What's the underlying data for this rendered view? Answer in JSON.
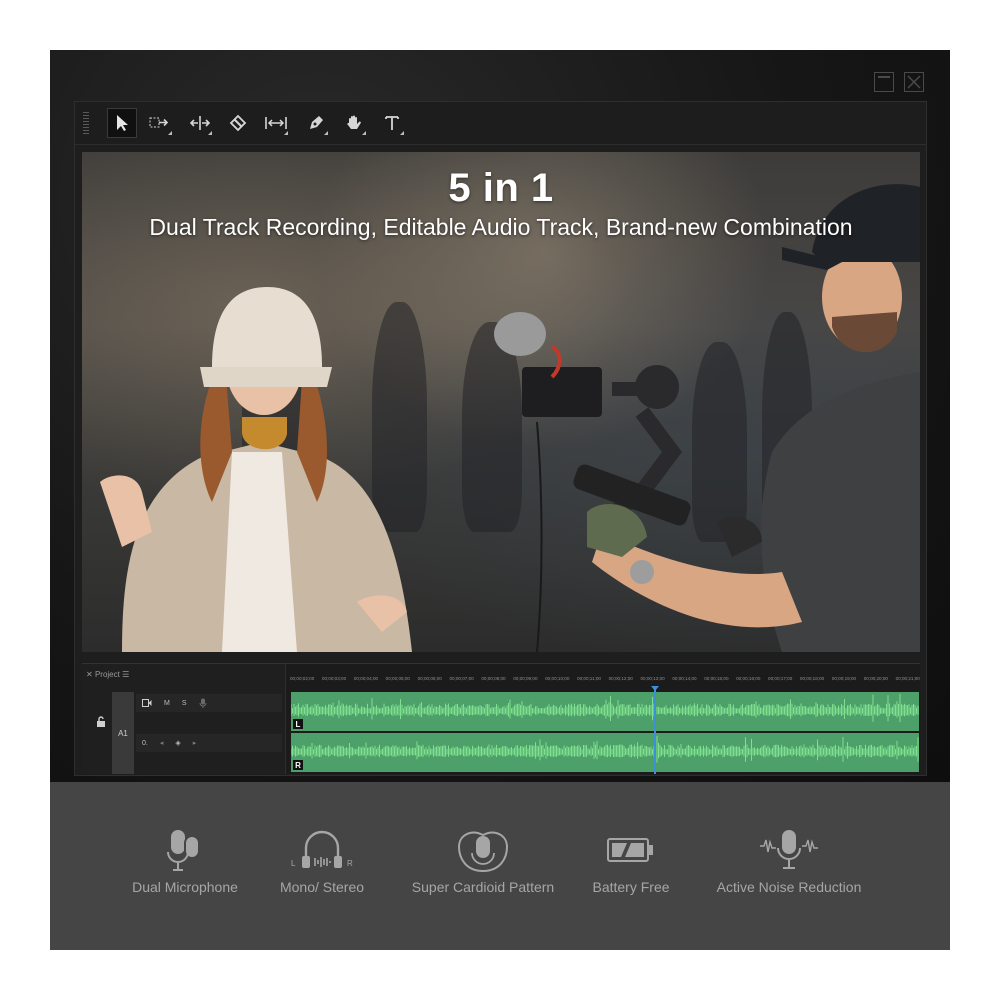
{
  "editor": {
    "toolbar": {
      "tools": [
        {
          "icon": "selection-arrow-icon"
        },
        {
          "icon": "track-select-icon"
        },
        {
          "icon": "ripple-edit-icon"
        },
        {
          "icon": "razor-icon"
        },
        {
          "icon": "slip-icon"
        },
        {
          "icon": "pen-icon"
        },
        {
          "icon": "hand-icon"
        },
        {
          "icon": "type-icon"
        }
      ]
    },
    "preview": {
      "headline": "5 in 1",
      "subheadline": "Dual Track Recording, Editable Audio Track, Brand-new Combination"
    },
    "timeline": {
      "panel_tab": "Project",
      "track_name": "A1",
      "mute_label": "M",
      "solo_label": "S",
      "volume_value": "0.",
      "channel_left": "L",
      "channel_right": "R",
      "ruler_marks": [
        "00;00;02;00",
        "00;00;03;00",
        "00;00;04;00",
        "00;00;05;00",
        "00;00;06;00",
        "00;00;07;00",
        "00;00;08;00",
        "00;00;09;00",
        "00;00;10;00",
        "00;00;11;00",
        "00;00;12;00",
        "00;00;13;00",
        "00;00;14;00",
        "00;00;15;00",
        "00;00;16;00",
        "00;00;17;00",
        "00;00;18;00",
        "00;00;19;00",
        "00;00;20;00",
        "00;00;21;00"
      ],
      "waveform_color": "#7fe08f",
      "playhead_color": "#3d8fd8"
    }
  },
  "features": [
    {
      "icon": "dual-microphone-icon",
      "label": "Dual Microphone"
    },
    {
      "icon": "headphones-icon",
      "label": "Mono/ Stereo",
      "left_mark": "L",
      "right_mark": "R"
    },
    {
      "icon": "cardioid-pattern-icon",
      "label": "Super Cardioid Pattern"
    },
    {
      "icon": "battery-icon",
      "label": "Battery Free"
    },
    {
      "icon": "noise-reduction-icon",
      "label": "Active Noise Reduction"
    }
  ]
}
